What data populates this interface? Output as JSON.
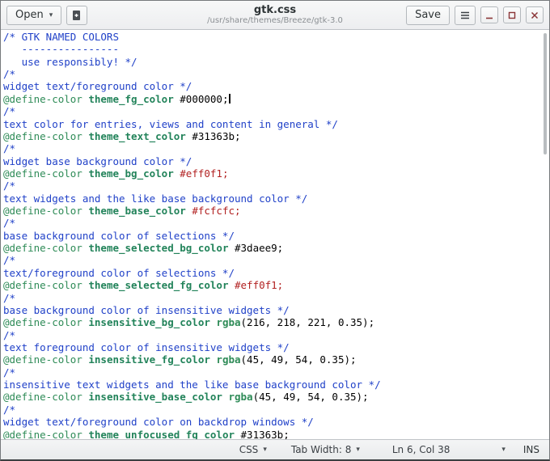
{
  "header": {
    "open_label": "Open",
    "title": "gtk.css",
    "subtitle": "/usr/share/themes/Breeze/gtk-3.0",
    "save_label": "Save"
  },
  "icons": {
    "dropdown_arrow": "▾",
    "new_document": "new-document-icon",
    "menu": "hamburger-icon",
    "minimize": "minimize-icon",
    "maximize": "maximize-icon",
    "close": "close-icon"
  },
  "statusbar": {
    "language": "CSS",
    "tab_width_label": "Tab Width: 8",
    "position": "Ln 6, Col 38",
    "mode": "INS"
  },
  "colors": {
    "comment": "#2041c8",
    "keyword": "#2e8b57",
    "name": "#22835a",
    "func": "#2e8b57",
    "hex": "#000000",
    "hexred": "#b22222",
    "text": "#000000",
    "window_controls": "#8a3537"
  },
  "editor": {
    "cursor_line": 6,
    "lines": [
      [
        [
          "comment",
          "/* GTK NAMED COLORS"
        ]
      ],
      [
        [
          "comment",
          "   ----------------"
        ]
      ],
      [
        [
          "comment",
          "   use responsibly! */"
        ]
      ],
      [
        [
          "comment",
          "/*"
        ]
      ],
      [
        [
          "comment",
          "widget text/foreground color */"
        ]
      ],
      [
        [
          "keyword",
          "@define-color"
        ],
        [
          "plain",
          " "
        ],
        [
          "name",
          "theme_fg_color"
        ],
        [
          "plain",
          " "
        ],
        [
          "hex",
          "#000000;"
        ]
      ],
      [
        [
          "comment",
          "/*"
        ]
      ],
      [
        [
          "comment",
          "text color for entries, views and content in general */"
        ]
      ],
      [
        [
          "keyword",
          "@define-color"
        ],
        [
          "plain",
          " "
        ],
        [
          "name",
          "theme_text_color"
        ],
        [
          "plain",
          " "
        ],
        [
          "hex",
          "#31363b;"
        ]
      ],
      [
        [
          "comment",
          "/*"
        ]
      ],
      [
        [
          "comment",
          "widget base background color */"
        ]
      ],
      [
        [
          "keyword",
          "@define-color"
        ],
        [
          "plain",
          " "
        ],
        [
          "name",
          "theme_bg_color"
        ],
        [
          "plain",
          " "
        ],
        [
          "hexred",
          "#eff0f1;"
        ]
      ],
      [
        [
          "comment",
          "/*"
        ]
      ],
      [
        [
          "comment",
          "text widgets and the like base background color */"
        ]
      ],
      [
        [
          "keyword",
          "@define-color"
        ],
        [
          "plain",
          " "
        ],
        [
          "name",
          "theme_base_color"
        ],
        [
          "plain",
          " "
        ],
        [
          "hexred",
          "#fcfcfc;"
        ]
      ],
      [
        [
          "comment",
          "/*"
        ]
      ],
      [
        [
          "comment",
          "base background color of selections */"
        ]
      ],
      [
        [
          "keyword",
          "@define-color"
        ],
        [
          "plain",
          " "
        ],
        [
          "name",
          "theme_selected_bg_color"
        ],
        [
          "plain",
          " "
        ],
        [
          "hex",
          "#3daee9;"
        ]
      ],
      [
        [
          "comment",
          "/*"
        ]
      ],
      [
        [
          "comment",
          "text/foreground color of selections */"
        ]
      ],
      [
        [
          "keyword",
          "@define-color"
        ],
        [
          "plain",
          " "
        ],
        [
          "name",
          "theme_selected_fg_color"
        ],
        [
          "plain",
          " "
        ],
        [
          "hexred",
          "#eff0f1;"
        ]
      ],
      [
        [
          "comment",
          "/*"
        ]
      ],
      [
        [
          "comment",
          "base background color of insensitive widgets */"
        ]
      ],
      [
        [
          "keyword",
          "@define-color"
        ],
        [
          "plain",
          " "
        ],
        [
          "name",
          "insensitive_bg_color"
        ],
        [
          "plain",
          " "
        ],
        [
          "func",
          "rgba"
        ],
        [
          "plain",
          "(216, 218, 221, 0.35);"
        ]
      ],
      [
        [
          "comment",
          "/*"
        ]
      ],
      [
        [
          "comment",
          "text foreground color of insensitive widgets */"
        ]
      ],
      [
        [
          "keyword",
          "@define-color"
        ],
        [
          "plain",
          " "
        ],
        [
          "name",
          "insensitive_fg_color"
        ],
        [
          "plain",
          " "
        ],
        [
          "func",
          "rgba"
        ],
        [
          "plain",
          "(45, 49, 54, 0.35);"
        ]
      ],
      [
        [
          "comment",
          "/*"
        ]
      ],
      [
        [
          "comment",
          "insensitive text widgets and the like base background color */"
        ]
      ],
      [
        [
          "keyword",
          "@define-color"
        ],
        [
          "plain",
          " "
        ],
        [
          "name",
          "insensitive_base_color"
        ],
        [
          "plain",
          " "
        ],
        [
          "func",
          "rgba"
        ],
        [
          "plain",
          "(45, 49, 54, 0.35);"
        ]
      ],
      [
        [
          "comment",
          "/*"
        ]
      ],
      [
        [
          "comment",
          "widget text/foreground color on backdrop windows */"
        ]
      ],
      [
        [
          "keyword",
          "@define-color"
        ],
        [
          "plain",
          " "
        ],
        [
          "name",
          "theme_unfocused_fg_color"
        ],
        [
          "plain",
          " "
        ],
        [
          "hex",
          "#31363b;"
        ]
      ]
    ]
  }
}
